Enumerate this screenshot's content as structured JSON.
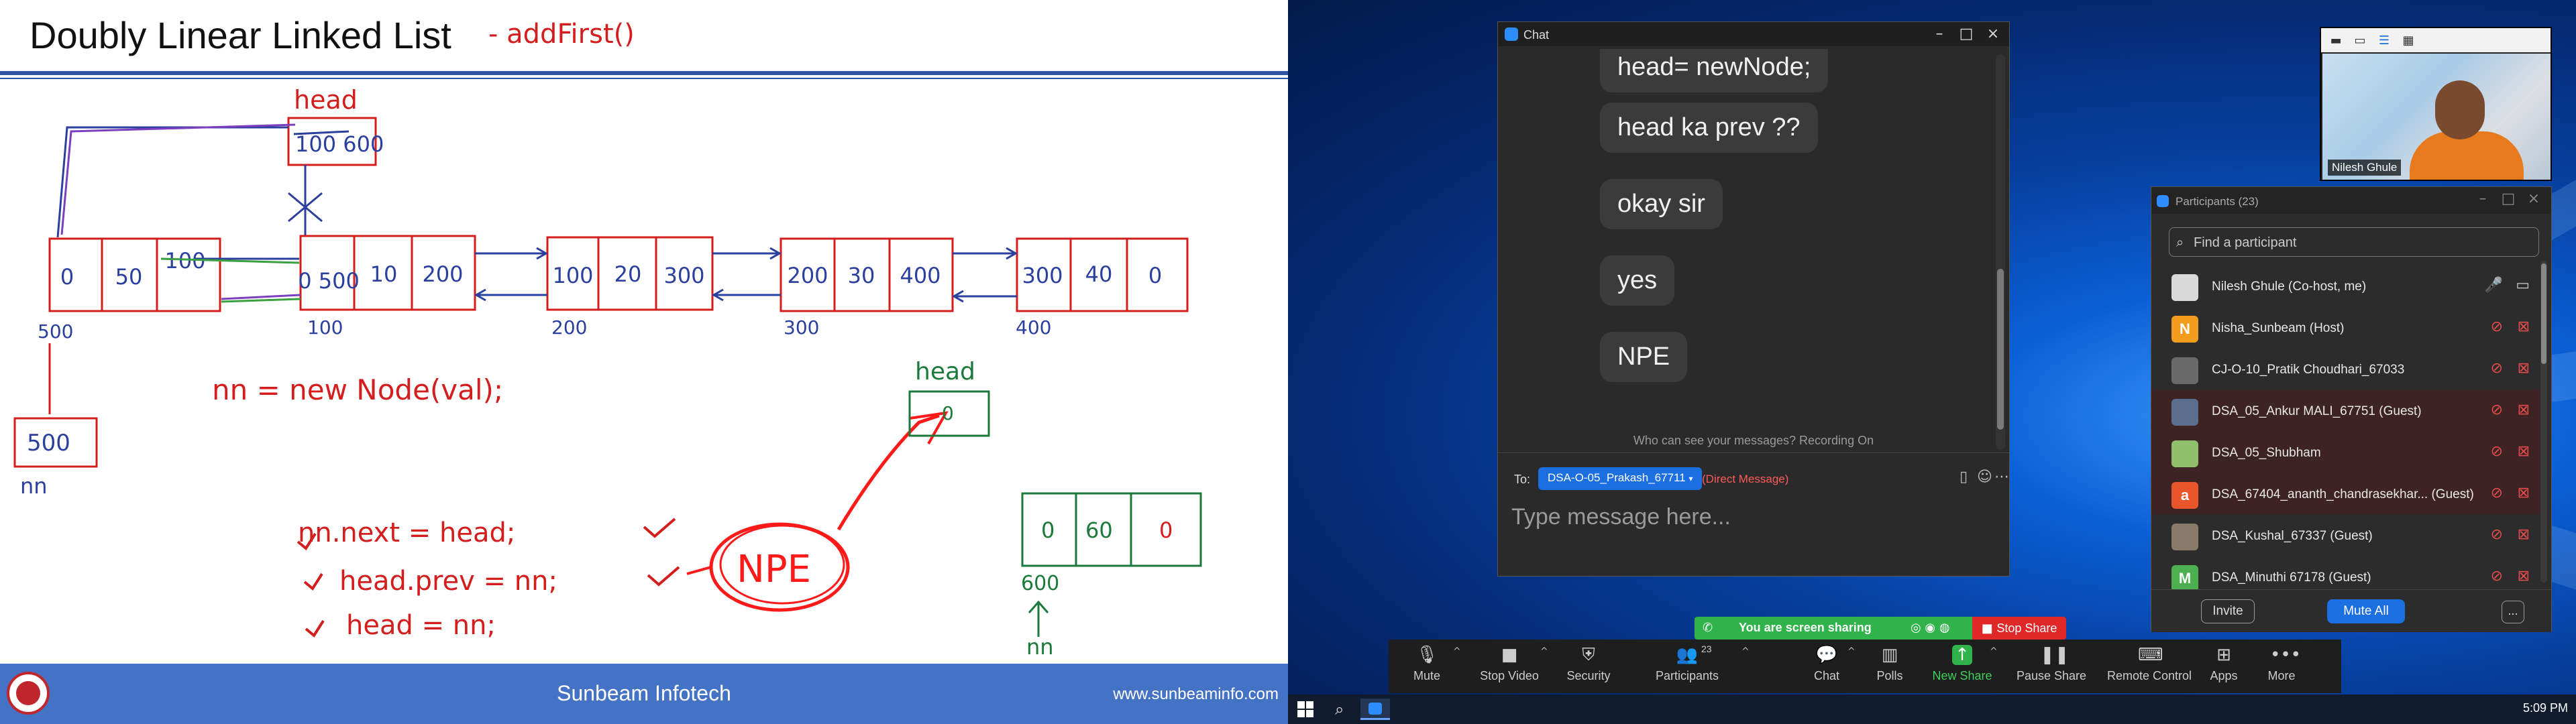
{
  "slide": {
    "title": "Doubly Linear Linked List",
    "footer_company": "Sunbeam Infotech",
    "footer_url": "www.sunbeaminfo.com",
    "annotations": {
      "heading_note": "- addFirst()",
      "head_label": "head",
      "head_values": "100 600",
      "nodes": [
        {
          "prev": "0",
          "data": "50",
          "next": "100",
          "addr": "500"
        },
        {
          "prev": "0 500",
          "data": "10",
          "next": "200",
          "addr": "100"
        },
        {
          "prev": "100",
          "data": "20",
          "next": "300",
          "addr": "200"
        },
        {
          "prev": "200",
          "data": "30",
          "next": "400",
          "addr": "300"
        },
        {
          "prev": "300",
          "data": "40",
          "next": "0",
          "addr": "400"
        }
      ],
      "nn_box": "500",
      "nn_label": "nn",
      "new_node_stmt": "nn = new Node(val);",
      "step1": "nn.next = head;",
      "step2": "head.prev = nn;",
      "step3": "head = nn;",
      "npe": "NPE",
      "green_head_label": "head",
      "green_head_value": "0",
      "green_node": {
        "prev": "0",
        "data": "60",
        "next": "0"
      },
      "green_addr": "600",
      "green_nn": "nn"
    }
  },
  "chat": {
    "window_title": "Chat",
    "messages": [
      "head= newNode;",
      "head ka prev ??",
      "okay sir",
      "yes",
      "NPE"
    ],
    "notice": "Who can see your messages? Recording On",
    "to_label": "To:",
    "recipient": "DSA-O-05_Prakash_67711",
    "direct_label": "(Direct Message)",
    "input_placeholder": "Type message here..."
  },
  "video": {
    "name": "Nilesh Ghule"
  },
  "participants": {
    "title": "Participants (23)",
    "search_placeholder": "Find a participant",
    "list": [
      {
        "name": "Nilesh Ghule (Co-host, me)",
        "avatar": "",
        "color": "#d9d9d9",
        "active": false
      },
      {
        "name": "Nisha_Sunbeam (Host)",
        "avatar": "N",
        "color": "#f29b1d",
        "active": false
      },
      {
        "name": "CJ-O-10_Pratik Choudhari_67033",
        "avatar": "",
        "color": "#6a6a6a",
        "active": false
      },
      {
        "name": "DSA_05_Ankur MALI_67751 (Guest)",
        "avatar": "",
        "color": "#5b6f8c",
        "active": true
      },
      {
        "name": "DSA_05_Shubham",
        "avatar": "",
        "color": "#8fbf6a",
        "active": true
      },
      {
        "name": "DSA_67404_ananth_chandrasekhar... (Guest)",
        "avatar": "a",
        "color": "#e8562a",
        "active": true
      },
      {
        "name": "DSA_Kushal_67337 (Guest)",
        "avatar": "",
        "color": "#8a7a6a",
        "active": false
      },
      {
        "name": "DSA_Minuthi 67178 (Guest)",
        "avatar": "M",
        "color": "#4caf50",
        "active": false
      }
    ],
    "invite_label": "Invite",
    "mute_all_label": "Mute All",
    "more_label": "..."
  },
  "sharing": {
    "text": "You are screen sharing",
    "stop_label": "Stop Share"
  },
  "toolbar": {
    "items": [
      {
        "label": "Mute",
        "icon": "microphone-icon"
      },
      {
        "label": "Stop Video",
        "icon": "video-camera-icon"
      },
      {
        "label": "Security",
        "icon": "shield-icon"
      },
      {
        "label": "Participants",
        "icon": "participants-icon",
        "count": "23"
      },
      {
        "label": "Chat",
        "icon": "chat-icon"
      },
      {
        "label": "Polls",
        "icon": "polls-icon"
      },
      {
        "label": "New Share",
        "icon": "share-arrow-icon"
      },
      {
        "label": "Pause Share",
        "icon": "pause-icon"
      },
      {
        "label": "Remote Control",
        "icon": "remote-control-icon"
      },
      {
        "label": "Apps",
        "icon": "apps-icon"
      },
      {
        "label": "More",
        "icon": "more-icon"
      }
    ]
  },
  "taskbar": {
    "clock": "5:09 PM"
  },
  "colors": {
    "red_ink": "#d41e1e",
    "blue_ink": "#2a3f9e",
    "green_ink": "#1b7a3a",
    "slide_blue": "#4472c4",
    "zoom_blue": "#1c6fe0"
  }
}
